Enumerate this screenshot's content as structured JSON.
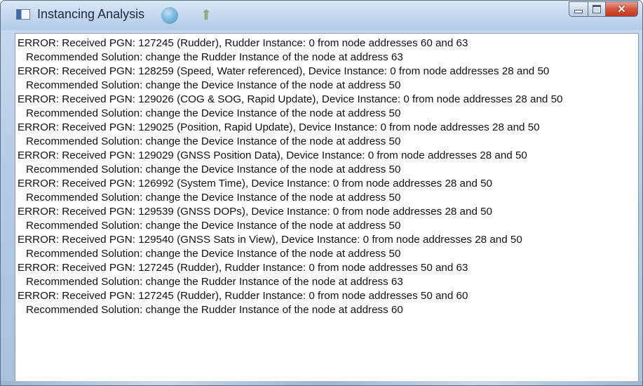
{
  "window": {
    "title": "Instancing Analysis",
    "icons": {
      "app": "window-app-icon",
      "globe": "globe-icon",
      "arrow": "arrow-up-icon",
      "minimize": "minimize-icon",
      "maximize": "maximize-icon",
      "close": "close-icon"
    }
  },
  "output": {
    "lines": [
      "ERROR: Received PGN: 127245 (Rudder), Rudder Instance: 0 from node addresses 60 and 63",
      "Recommended Solution: change the Rudder Instance of the node at address 63",
      "ERROR: Received PGN: 128259 (Speed, Water referenced), Device Instance: 0 from node addresses 28 and 50",
      "Recommended Solution: change the Device Instance of the node at address 50",
      "ERROR: Received PGN: 129026 (COG & SOG, Rapid Update), Device Instance: 0 from node addresses 28 and 50",
      "Recommended Solution: change the Device Instance of the node at address 50",
      "ERROR: Received PGN: 129025 (Position, Rapid Update), Device Instance: 0 from node addresses 28 and 50",
      "Recommended Solution: change the Device Instance of the node at address 50",
      "ERROR: Received PGN: 129029 (GNSS Position Data), Device Instance: 0 from node addresses 28 and 50",
      "Recommended Solution: change the Device Instance of the node at address 50",
      "ERROR: Received PGN: 126992 (System Time), Device Instance: 0 from node addresses 28 and 50",
      "Recommended Solution: change the Device Instance of the node at address 50",
      "ERROR: Received PGN: 129539 (GNSS DOPs), Device Instance: 0 from node addresses 28 and 50",
      "Recommended Solution: change the Device Instance of the node at address 50",
      "ERROR: Received PGN: 129540 (GNSS Sats in View), Device Instance: 0 from node addresses 28 and 50",
      "Recommended Solution: change the Device Instance of the node at address 50",
      "ERROR: Received PGN: 127245 (Rudder), Rudder Instance: 0 from node addresses 50 and 63",
      "Recommended Solution: change the Rudder Instance of the node at address 63",
      "ERROR: Received PGN: 127245 (Rudder), Rudder Instance: 0 from node addresses 50 and 60",
      "Recommended Solution: change the Rudder Instance of the node at address 60"
    ]
  }
}
